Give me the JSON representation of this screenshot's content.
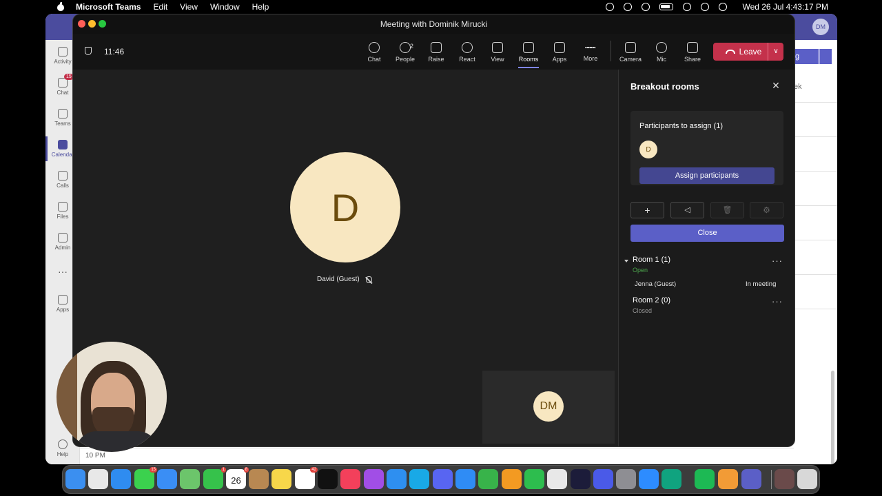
{
  "menubar": {
    "app_name": "Microsoft Teams",
    "menus": [
      "Edit",
      "View",
      "Window",
      "Help"
    ],
    "clock": "Wed 26 Jul  4:43:17 PM"
  },
  "background_window": {
    "avatar_initials": "DM",
    "rail": [
      {
        "label": "Activity",
        "icon": "bell-icon"
      },
      {
        "label": "Chat",
        "icon": "chat-icon",
        "badge": "15"
      },
      {
        "label": "Teams",
        "icon": "teams-icon"
      },
      {
        "label": "Calendar",
        "icon": "calendar-icon",
        "active": true
      },
      {
        "label": "Calls",
        "icon": "phone-icon"
      },
      {
        "label": "Files",
        "icon": "file-icon"
      },
      {
        "label": "Admin",
        "icon": "admin-icon"
      },
      {
        "label": "Apps",
        "icon": "apps-icon"
      },
      {
        "label": "Help",
        "icon": "help-icon"
      }
    ],
    "more_label": "···",
    "partial_button_text": "g",
    "partial_view_text": "ek",
    "time_label": "10 PM"
  },
  "meeting": {
    "window_title": "Meeting with Dominik Mirucki",
    "timer": "11:46",
    "toolbar": [
      {
        "label": "Chat",
        "icon": "chat-icon"
      },
      {
        "label": "People",
        "icon": "people-icon",
        "count": "2"
      },
      {
        "label": "Raise",
        "icon": "hand-icon"
      },
      {
        "label": "React",
        "icon": "smiley-icon"
      },
      {
        "label": "View",
        "icon": "grid-icon"
      },
      {
        "label": "Rooms",
        "icon": "rooms-icon",
        "active": true
      },
      {
        "label": "Apps",
        "icon": "plus-icon"
      },
      {
        "label": "More",
        "icon": "ellipsis-icon"
      },
      {
        "label": "Camera",
        "icon": "camera-off-icon"
      },
      {
        "label": "Mic",
        "icon": "mic-off-icon"
      },
      {
        "label": "Share",
        "icon": "share-icon"
      }
    ],
    "leave_label": "Leave",
    "main_participant": {
      "initial": "D",
      "name": "David (Guest)"
    },
    "self_initials": "DM"
  },
  "breakout": {
    "title": "Breakout rooms",
    "assign_title": "Participants to assign (1)",
    "unassigned_initial": "D",
    "assign_button": "Assign participants",
    "controls": [
      {
        "icon": "add-room-icon",
        "glyph": "+"
      },
      {
        "icon": "announce-icon",
        "glyph": "◁"
      },
      {
        "icon": "delete-icon",
        "glyph": "🗑"
      },
      {
        "icon": "settings-icon",
        "glyph": "⚙"
      }
    ],
    "close_button": "Close",
    "rooms": [
      {
        "name": "Room 1  (1)",
        "status": "Open",
        "status_color": "#4ca64c",
        "members": [
          {
            "name": "Jenna (Guest)",
            "status": "In meeting"
          }
        ]
      },
      {
        "name": "Room 2  (0)",
        "status": "Closed",
        "status_color": "#9a9a9a",
        "members": []
      }
    ],
    "more_glyph": "···"
  },
  "dock": {
    "apps": [
      {
        "name": "finder",
        "color": "#3b8ff0"
      },
      {
        "name": "launchpad",
        "color": "#e8e8e8"
      },
      {
        "name": "safari",
        "color": "#2f8cf0"
      },
      {
        "name": "messages",
        "color": "#3bd14e",
        "badge": "15"
      },
      {
        "name": "mail",
        "color": "#3a8ef5"
      },
      {
        "name": "maps",
        "color": "#6cc56b"
      },
      {
        "name": "facetime",
        "color": "#36c24b",
        "badge": "1"
      },
      {
        "name": "calendar",
        "color": "#ffffff",
        "day": "26",
        "badge": "8"
      },
      {
        "name": "contacts",
        "color": "#b88852"
      },
      {
        "name": "notes",
        "color": "#f7d74a"
      },
      {
        "name": "reminders",
        "color": "#ffffff",
        "badge": "42"
      },
      {
        "name": "apple-tv",
        "color": "#111111"
      },
      {
        "name": "music",
        "color": "#f3405b"
      },
      {
        "name": "podcasts",
        "color": "#a14ee6"
      },
      {
        "name": "keynote",
        "color": "#2e8ff0"
      },
      {
        "name": "skype",
        "color": "#19a9e6"
      },
      {
        "name": "discord",
        "color": "#5865f2"
      },
      {
        "name": "app-store",
        "color": "#2f8cf5"
      },
      {
        "name": "numbers",
        "color": "#38b34a"
      },
      {
        "name": "pages",
        "color": "#f39a22"
      },
      {
        "name": "whatsapp",
        "color": "#2dbd4e"
      },
      {
        "name": "chrome",
        "color": "#e8e8e8"
      },
      {
        "name": "webex",
        "color": "#1c1c3a"
      },
      {
        "name": "photos-like",
        "color": "#4a5ae8"
      },
      {
        "name": "system-prefs",
        "color": "#8e8e93"
      },
      {
        "name": "zoom",
        "color": "#2d8cff"
      },
      {
        "name": "chatgpt",
        "color": "#10a37f"
      },
      {
        "name": "spotify",
        "color": "#1db954"
      },
      {
        "name": "garageband",
        "color": "#f29b36"
      },
      {
        "name": "teams",
        "color": "#5b5fc7"
      },
      {
        "name": "photo-stack",
        "color": "#6a4a4a"
      },
      {
        "name": "trash",
        "color": "#d8d8d8"
      }
    ]
  }
}
